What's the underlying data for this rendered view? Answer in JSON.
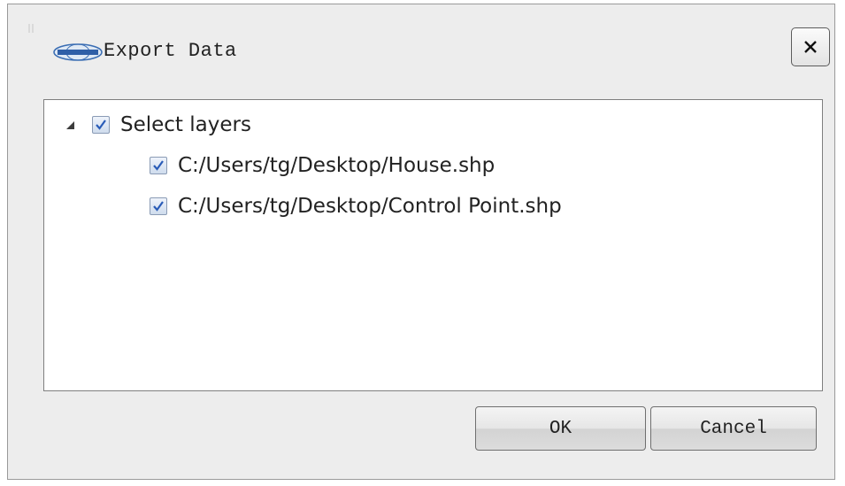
{
  "dialog": {
    "title": "Export Data",
    "logo_icon": "app-logo-icon",
    "close_icon": "close-icon"
  },
  "tree": {
    "root": {
      "label": "Select layers",
      "checked": true,
      "expanded": true
    },
    "children": [
      {
        "label": "C:/Users/tg/Desktop/House.shp",
        "checked": true
      },
      {
        "label": "C:/Users/tg/Desktop/Control Point.shp",
        "checked": true
      }
    ]
  },
  "buttons": {
    "ok_label": "OK",
    "cancel_label": "Cancel"
  },
  "colors": {
    "check_mark": "#2a5cb8",
    "dialog_bg": "#ededed"
  }
}
